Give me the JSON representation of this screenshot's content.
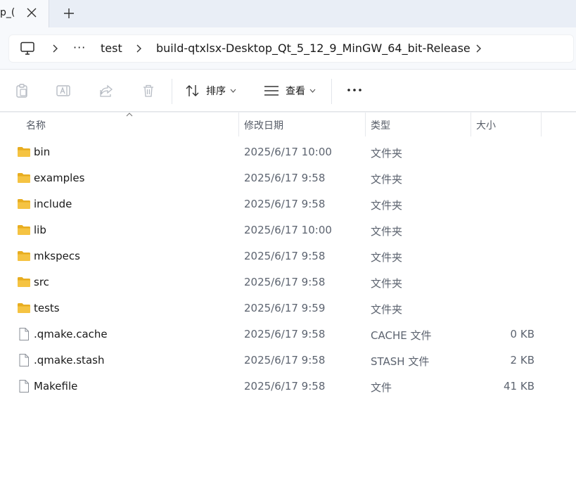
{
  "tab": {
    "title": "p_("
  },
  "breadcrumb": {
    "ellipsis": "···",
    "items": [
      "test",
      "build-qtxlsx-Desktop_Qt_5_12_9_MinGW_64_bit-Release"
    ]
  },
  "toolbar": {
    "sort_label": "排序",
    "view_label": "查看"
  },
  "columns": {
    "name": "名称",
    "date": "修改日期",
    "type": "类型",
    "size": "大小"
  },
  "files": [
    {
      "name": "bin",
      "date": "2025/6/17 10:00",
      "type": "文件夹",
      "size": "",
      "icon": "folder-icon"
    },
    {
      "name": "examples",
      "date": "2025/6/17 9:58",
      "type": "文件夹",
      "size": "",
      "icon": "folder-icon"
    },
    {
      "name": "include",
      "date": "2025/6/17 9:58",
      "type": "文件夹",
      "size": "",
      "icon": "folder-icon"
    },
    {
      "name": "lib",
      "date": "2025/6/17 10:00",
      "type": "文件夹",
      "size": "",
      "icon": "folder-icon"
    },
    {
      "name": "mkspecs",
      "date": "2025/6/17 9:58",
      "type": "文件夹",
      "size": "",
      "icon": "folder-icon"
    },
    {
      "name": "src",
      "date": "2025/6/17 9:58",
      "type": "文件夹",
      "size": "",
      "icon": "folder-icon"
    },
    {
      "name": "tests",
      "date": "2025/6/17 9:59",
      "type": "文件夹",
      "size": "",
      "icon": "folder-icon"
    },
    {
      "name": ".qmake.cache",
      "date": "2025/6/17 9:58",
      "type": "CACHE 文件",
      "size": "0 KB",
      "icon": "file-icon"
    },
    {
      "name": ".qmake.stash",
      "date": "2025/6/17 9:58",
      "type": "STASH 文件",
      "size": "2 KB",
      "icon": "file-icon"
    },
    {
      "name": "Makefile",
      "date": "2025/6/17 9:58",
      "type": "文件",
      "size": "41 KB",
      "icon": "file-icon"
    }
  ],
  "colors": {
    "folder": "#f5c342",
    "folder_dark": "#e8ad20",
    "accent": "#0067c0"
  }
}
